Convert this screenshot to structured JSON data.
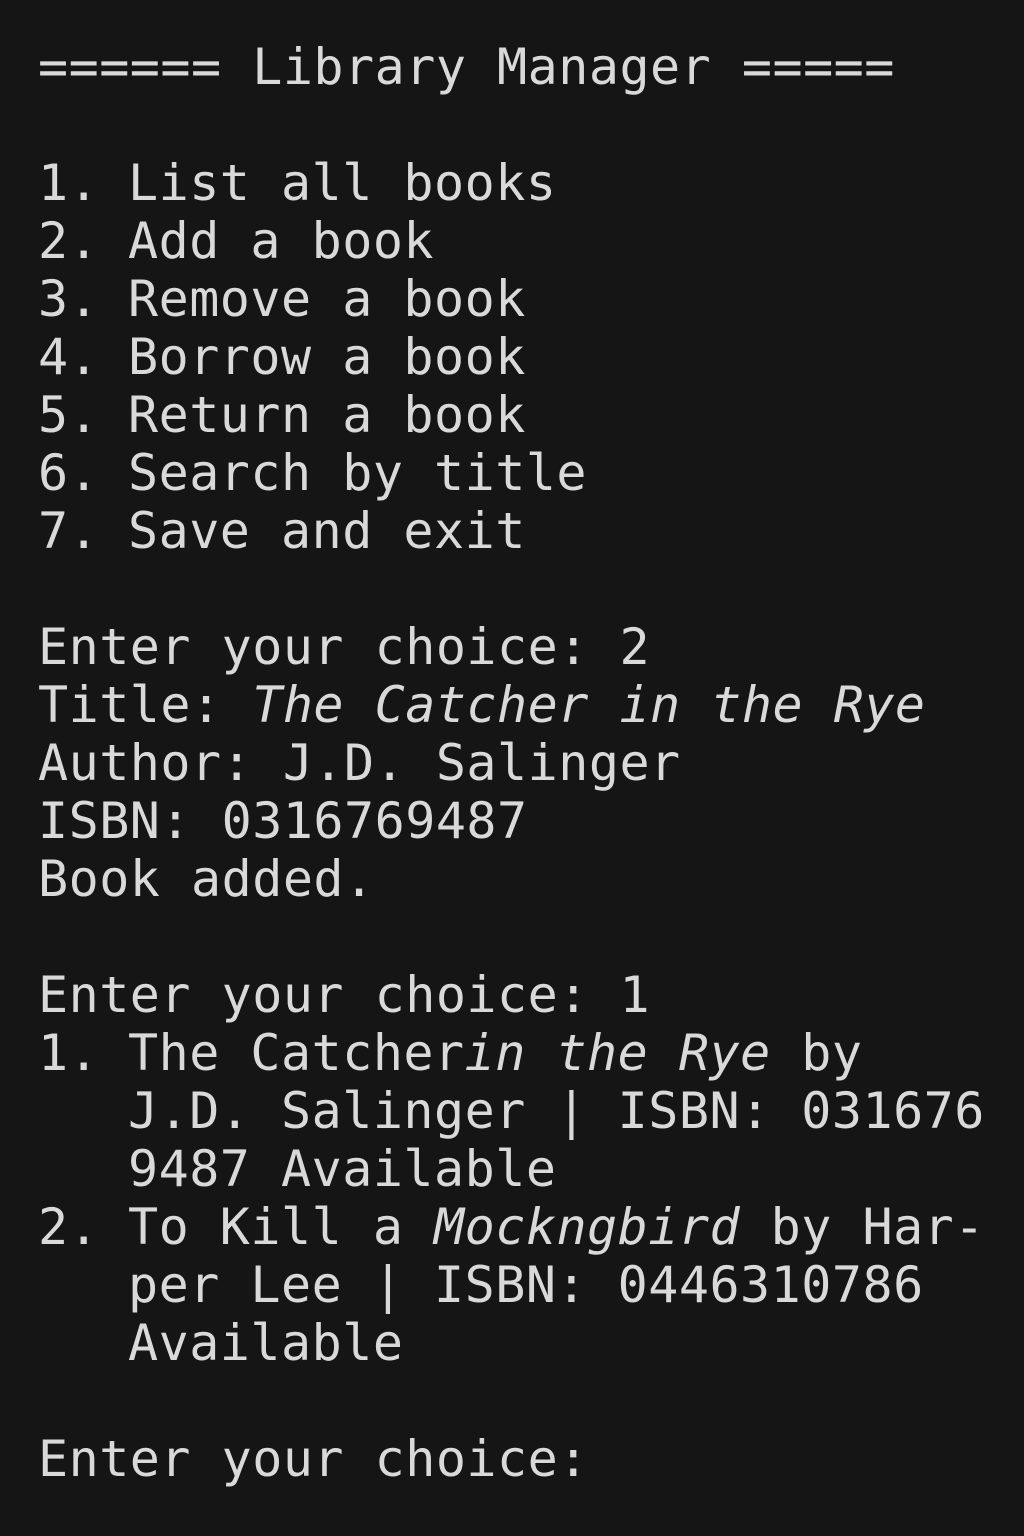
{
  "header": {
    "title": "====== Library Manager ====="
  },
  "menu": {
    "items": [
      {
        "num": "1.",
        "label": "List all books"
      },
      {
        "num": "2.",
        "label": "Add a book"
      },
      {
        "num": "3.",
        "label": "Remove a book"
      },
      {
        "num": "4.",
        "label": "Borrow a book"
      },
      {
        "num": "5.",
        "label": "Return a book"
      },
      {
        "num": "6.",
        "label": "Search by title"
      },
      {
        "num": "7.",
        "label": "Save and exit"
      }
    ]
  },
  "session": {
    "prompt1": "Enter your choice: 2",
    "title_label": "Title: ",
    "title_value": "The Catcher in the Rye",
    "author_line": "Author: J.D. Salinger",
    "isbn_line": "ISBN: 0316769487",
    "added_line": "Book added.",
    "prompt2": "Enter your choice: 1",
    "books": [
      {
        "num": "1.",
        "line1_a": "The Catcher",
        "line1_b": "in the Rye",
        "line1_c": " by",
        "line2": "J.D. Salinger | ISBN: 031676",
        "line3": "9487 Available"
      },
      {
        "num": "2.",
        "line1_a": "To Kill a ",
        "line1_b": "Mockngbird",
        "line1_c": " by Har-",
        "line2": "per Lee | ISBN: 0446310786",
        "line3": "Available"
      }
    ],
    "prompt3": "Enter your choice:"
  }
}
